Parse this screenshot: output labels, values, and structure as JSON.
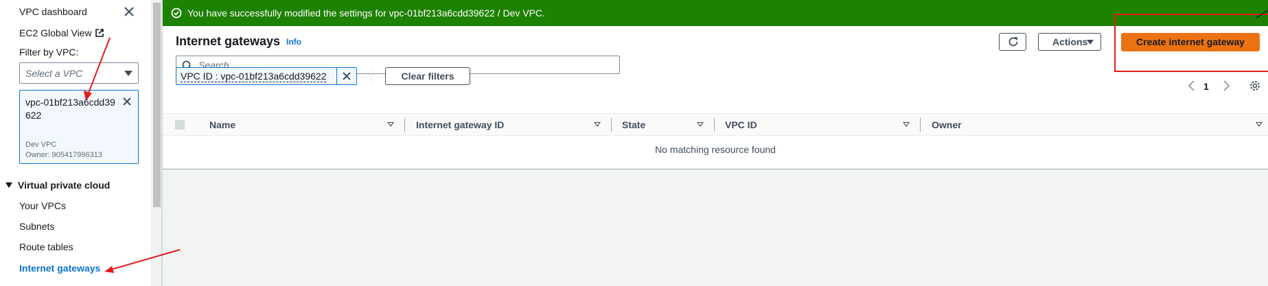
{
  "sidebar": {
    "vpc_dashboard": "VPC dashboard",
    "ec2_global_view": "EC2 Global View",
    "filter_label": "Filter by VPC:",
    "select_placeholder": "Select a VPC",
    "token": {
      "vpc_id": "vpc-01bf213a6cdd39622",
      "description": "Dev VPC",
      "owner": "Owner: 905417996313"
    },
    "section_heading": "Virtual private cloud",
    "items": [
      {
        "label": "Your VPCs"
      },
      {
        "label": "Subnets"
      },
      {
        "label": "Route tables"
      },
      {
        "label": "Internet gateways",
        "active": true
      }
    ]
  },
  "flash": {
    "message": "You have successfully modified the settings for vpc-01bf213a6cdd39622 / Dev VPC.",
    "color": "#1d8102"
  },
  "header": {
    "title": "Internet gateways",
    "info": "Info",
    "actions_label": "Actions",
    "create_label": "Create internet gateway"
  },
  "search": {
    "placeholder": "Search"
  },
  "filter": {
    "token_label": "VPC ID : vpc-01bf213a6cdd39622",
    "clear_label": "Clear filters"
  },
  "pagination": {
    "current_page": "1"
  },
  "table": {
    "columns": [
      "Name",
      "Internet gateway ID",
      "State",
      "VPC ID",
      "Owner"
    ],
    "empty_message": "No matching resource found"
  },
  "colors": {
    "accent": "#0972d3",
    "primary_button": "#ec7211",
    "success": "#1d8102",
    "annotation": "#e31b1b"
  }
}
